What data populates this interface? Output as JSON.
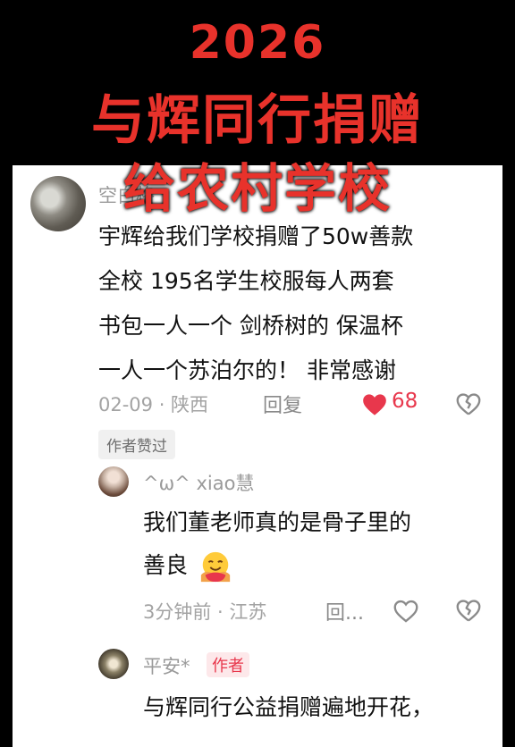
{
  "banner": {
    "line1": "2026",
    "line2": "与辉同行捐赠",
    "line3": "给农村学校"
  },
  "comment": {
    "username": "空白格",
    "lines": [
      "宇辉给我们学校捐赠了50w善款",
      "全校 195名学生校服每人两套",
      "书包一人一个 剑桥树的   保温杯",
      "一人一个苏泊尔的！  非常感谢"
    ],
    "meta": "02-09 · 陕西",
    "reply_label": "回复",
    "likes": "68",
    "liked_badge": "作者赞过"
  },
  "replies": [
    {
      "username": "^ω^ xiao慧",
      "lines": [
        "我们董老师真的是骨子里的",
        "善良"
      ],
      "meta": "3分钟前 · 江苏",
      "reply_label": "回..."
    },
    {
      "username": "平安*",
      "author_badge": "作者",
      "lines": [
        "与辉同行公益捐赠遍地开花，"
      ]
    }
  ],
  "colors": {
    "title_red": "#e8322b",
    "like_red": "#e8374c"
  },
  "icons": [
    "heart-icon",
    "broken-heart-icon",
    "hug-emoji-icon"
  ]
}
